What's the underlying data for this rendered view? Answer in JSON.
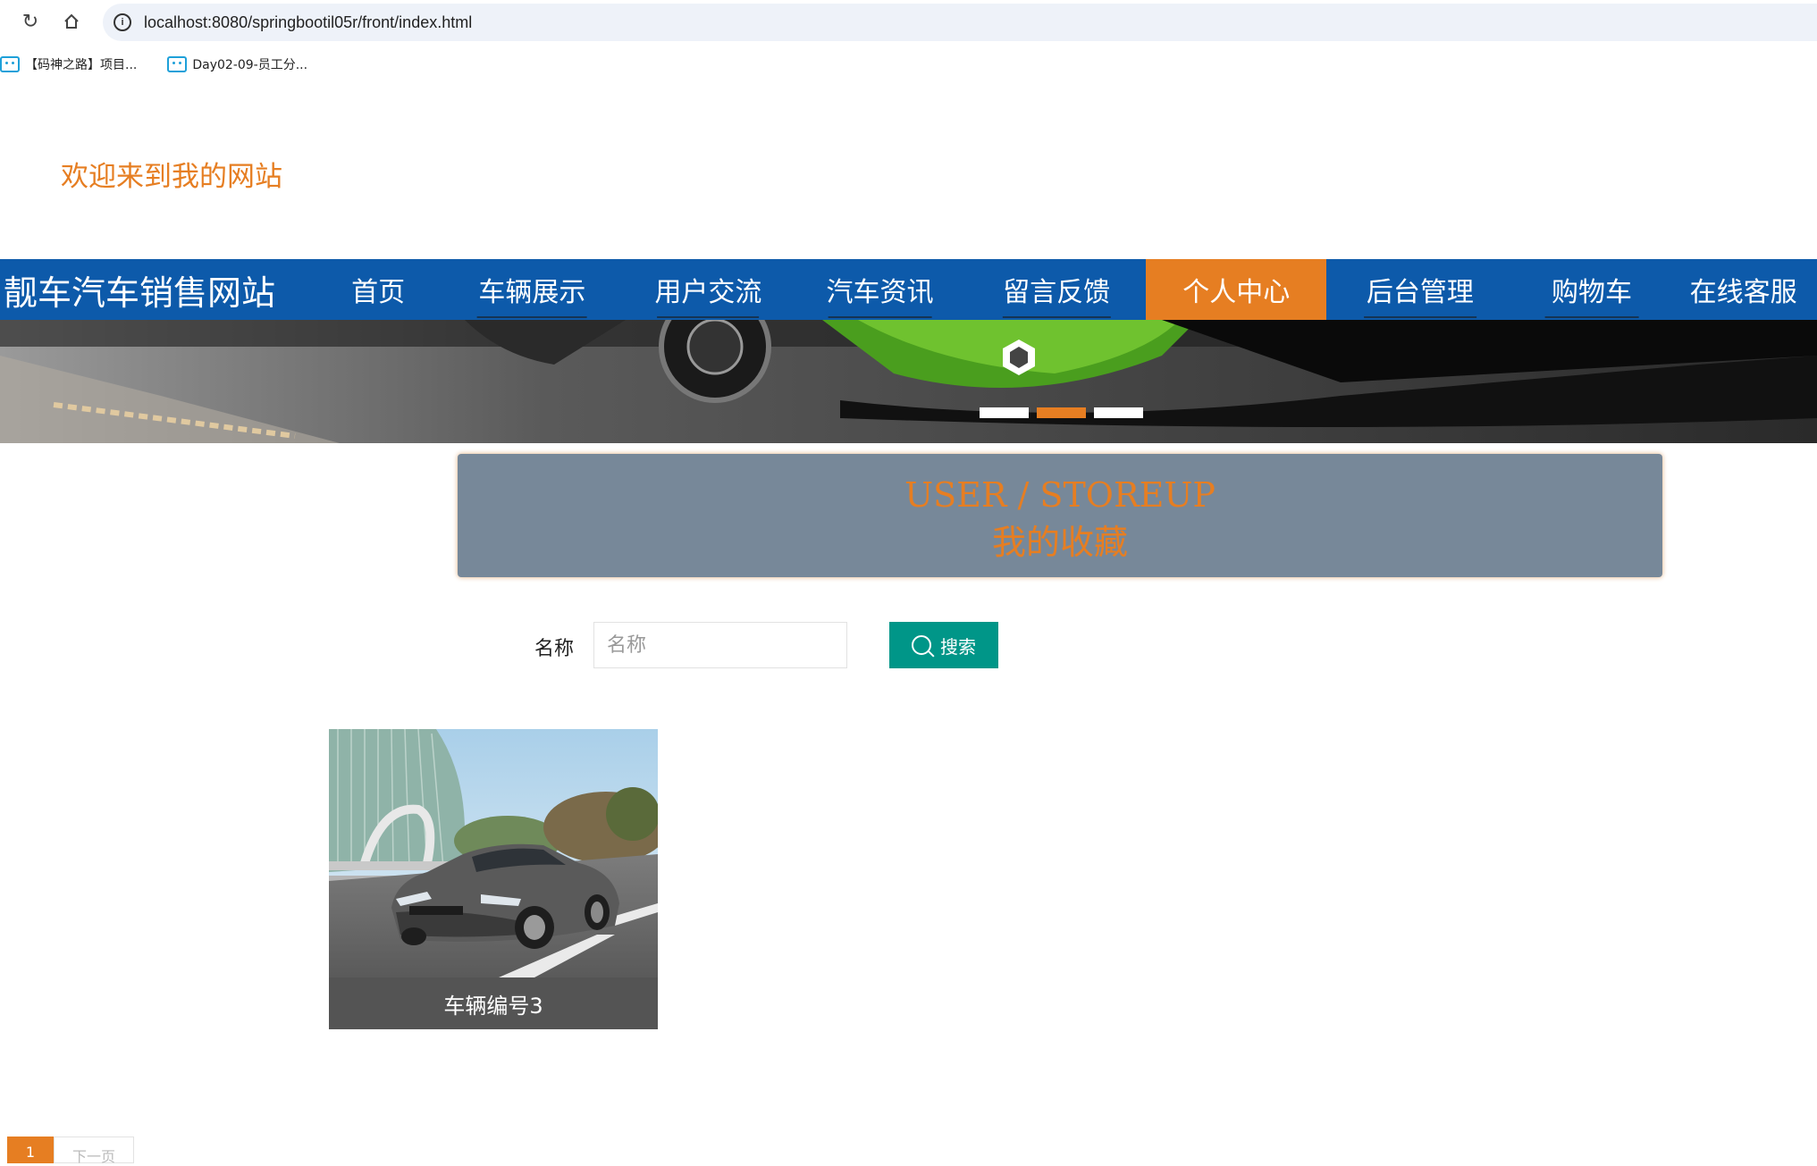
{
  "browser": {
    "url": "localhost:8080/springbootil05r/front/index.html",
    "bookmarks": [
      {
        "label": "【码神之路】项目..."
      },
      {
        "label": "Day02-09-员工分..."
      }
    ]
  },
  "header": {
    "welcome": "欢迎来到我的网站",
    "brand": "靓车汽车销售网站"
  },
  "nav": {
    "items": [
      {
        "label": "首页"
      },
      {
        "label": "车辆展示"
      },
      {
        "label": "用户交流"
      },
      {
        "label": "汽车资讯"
      },
      {
        "label": "留言反馈"
      },
      {
        "label": "个人中心",
        "active": true
      },
      {
        "label": "后台管理"
      },
      {
        "label": "购物车"
      },
      {
        "label": "在线客服"
      }
    ]
  },
  "banner": {
    "slides": 3,
    "active_slide": 2
  },
  "title": {
    "english": "USER / STOREUP",
    "chinese": "我的收藏"
  },
  "search": {
    "label": "名称",
    "placeholder": "名称",
    "button": "搜索"
  },
  "cards": [
    {
      "caption": "车辆编号3"
    }
  ],
  "pagination": {
    "current": "1",
    "next": "下一页"
  },
  "colors": {
    "nav_bg": "#0d5aaa",
    "accent": "#e67e22",
    "title_box": "#778899",
    "search_button": "#009688"
  }
}
